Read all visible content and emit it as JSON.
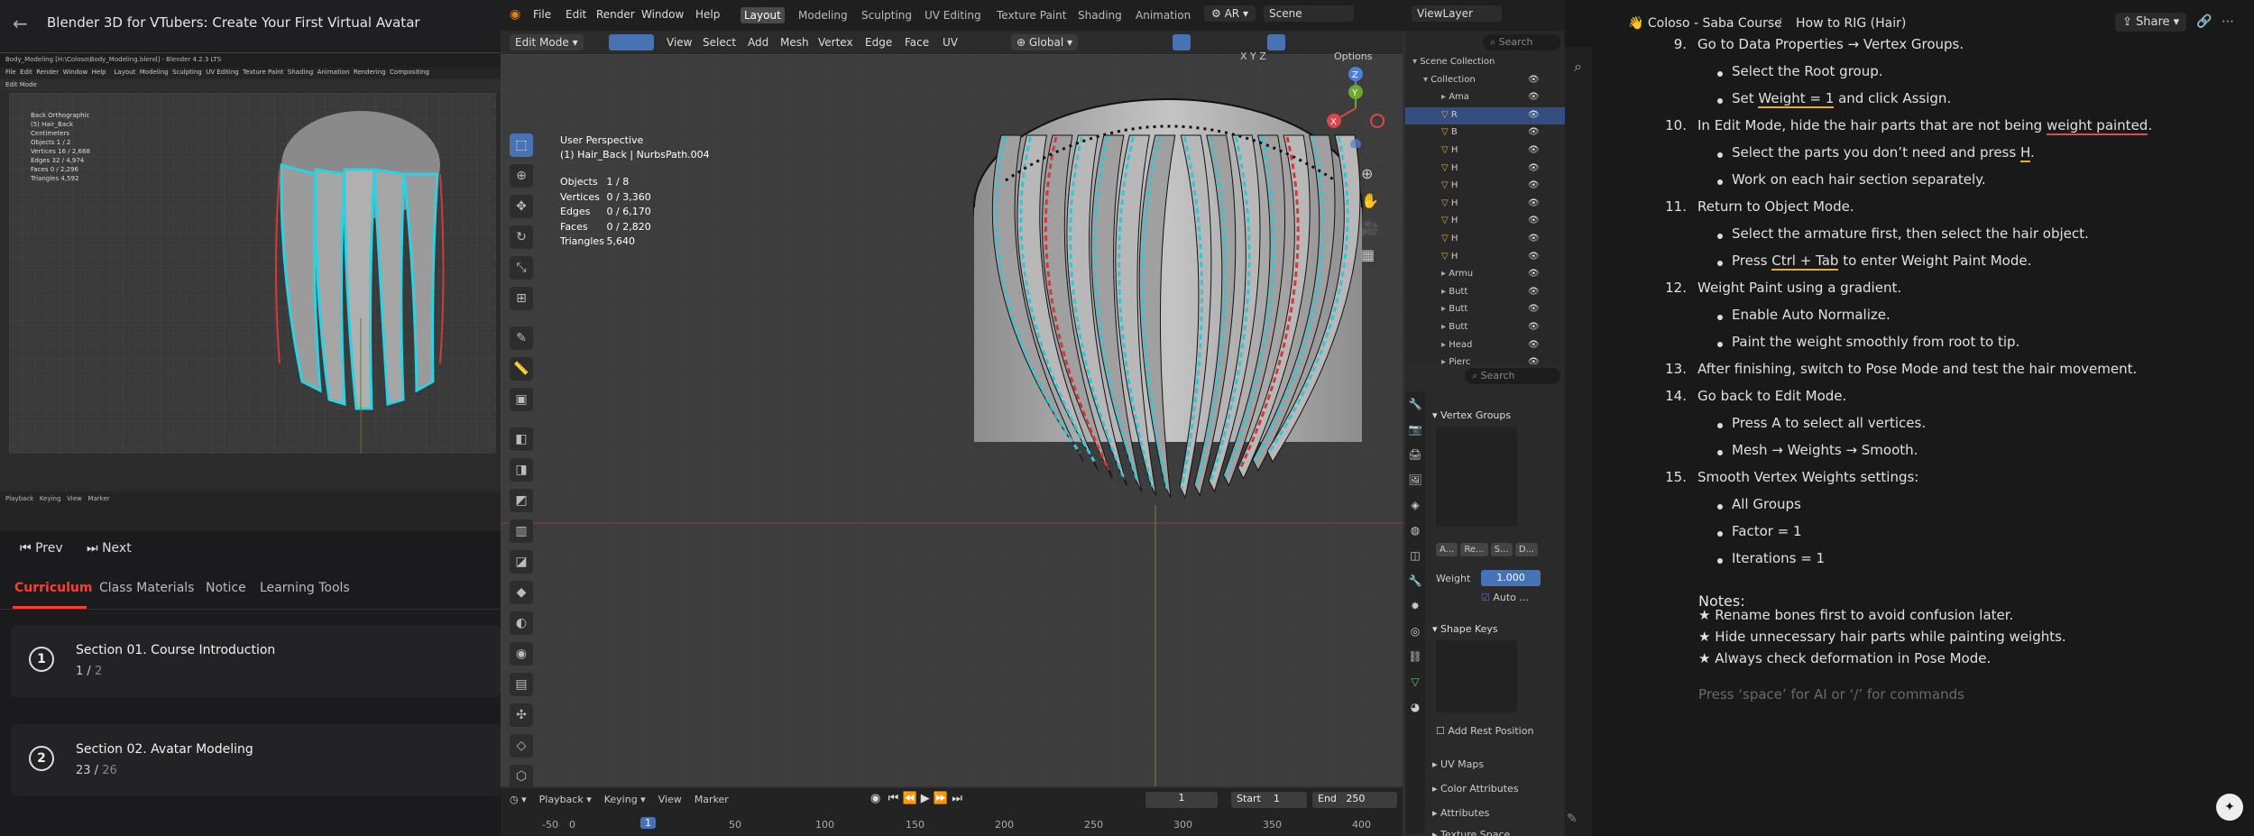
{
  "course": {
    "title": "Blender 3D for VTubers: Create Your First Virtual Avatar",
    "mini_window_title": "Body_Modeling [H:\\Coloso\\Body_Modeling.blend] - Blender 4.2.3 LTS",
    "mini_menu": [
      "File",
      "Edit",
      "Render",
      "Window",
      "Help"
    ],
    "mini_tabs": [
      "Layout",
      "Modeling",
      "Sculpting",
      "UV Editing",
      "Texture Paint",
      "Shading",
      "Animation",
      "Rendering",
      "Compositing"
    ],
    "mini_mode": "Edit Mode",
    "mini_stats": [
      "Back Orthographic",
      "(5) Hair_Back",
      "Centimeters",
      "Objects   1 / 2",
      "Vertices  16 / 2,688",
      "Edges     32 / 4,974",
      "Faces     0 / 2,296",
      "Triangles 4,592"
    ],
    "mini_timeline": [
      "Playback",
      "Keying",
      "View",
      "Marker"
    ],
    "prev_label": "Prev",
    "next_label": "Next",
    "tabs": [
      "Curriculum",
      "Class Materials",
      "Notice",
      "Learning Tools"
    ],
    "sections": [
      {
        "num": "1",
        "title": "Section 01. Course Introduction",
        "done": "1 /",
        "total": "2"
      },
      {
        "num": "2",
        "title": "Section 02. Avatar Modeling",
        "done": "23 /",
        "total": "26"
      }
    ]
  },
  "blender": {
    "menu": [
      "File",
      "Edit",
      "Render",
      "Window",
      "Help"
    ],
    "workspaces": [
      "Layout",
      "Modeling",
      "Sculpting",
      "UV Editing",
      "Texture Paint",
      "Shading",
      "Animation"
    ],
    "active_workspace": "Layout",
    "language": "AR",
    "scene": "Scene",
    "view_layer": "ViewLayer",
    "mode": "Edit Mode",
    "header_menus": [
      "View",
      "Select",
      "Add",
      "Mesh",
      "Vertex",
      "Edge",
      "Face",
      "UV"
    ],
    "orientation": "Global",
    "options_label": "Options",
    "axes": [
      "X",
      "Y",
      "Z"
    ],
    "view_name": "User Perspective",
    "object_name": "(1) Hair_Back | NurbsPath.004",
    "stats": [
      {
        "label": "Objects",
        "value": "1 / 8"
      },
      {
        "label": "Vertices",
        "value": "0 / 3,360"
      },
      {
        "label": "Edges",
        "value": "0 / 6,170"
      },
      {
        "label": "Faces",
        "value": "0 / 2,820"
      },
      {
        "label": "Triangles",
        "value": "5,640"
      }
    ],
    "timeline": {
      "menus": [
        "Playback",
        "Keying",
        "View",
        "Marker"
      ],
      "current_frame": "1",
      "start_label": "Start",
      "start": "1",
      "end_label": "End",
      "end": "250",
      "ruler": [
        "-50",
        "0",
        "1",
        "50",
        "100",
        "150",
        "200",
        "250",
        "300",
        "350",
        "400"
      ]
    },
    "outliner": {
      "search_placeholder": "Search",
      "items": [
        "Scene Collection",
        "Collection",
        "Ama",
        "R",
        "B",
        "H",
        "H",
        "H",
        "H",
        "H",
        "H",
        "H",
        "Armu",
        "Butt",
        "Butt",
        "Butt",
        "Head",
        "Pierc"
      ]
    },
    "properties": {
      "search_placeholder": "Search",
      "vertex_groups": "Vertex Groups",
      "vg_buttons": [
        "A...",
        "Re...",
        "S...",
        "D..."
      ],
      "weight_label": "Weight",
      "weight_value": "1.000",
      "auto_label": "Auto ...",
      "shape_keys": "Shape Keys",
      "add_rest": "Add Rest Position",
      "uv_maps": "UV Maps",
      "color_attributes": "Color Attributes",
      "attributes": "Attributes",
      "texture_space": "Texture Space"
    }
  },
  "notes": {
    "crumb_course": "Coloso - Saba Course",
    "crumb_page": "How to RIG (Hair)",
    "share_label": "Share",
    "items": [
      {
        "type": "num",
        "num": "9.",
        "text": "Go to Data Properties → Vertex Groups."
      },
      {
        "type": "bullet",
        "text": "Select the Root group."
      },
      {
        "type": "bullet",
        "parts": [
          "Set ",
          "Weight = 1",
          " and click Assign."
        ]
      },
      {
        "type": "num",
        "num": "10.",
        "parts": [
          "In Edit Mode, hide the hair parts that are not being ",
          "weight painted",
          "."
        ]
      },
      {
        "type": "bullet",
        "parts": [
          "Select the parts you don’t need and press ",
          "H",
          "."
        ]
      },
      {
        "type": "bullet",
        "text": "Work on each hair section separately."
      },
      {
        "type": "num",
        "num": "11.",
        "text": "Return to Object Mode."
      },
      {
        "type": "bullet",
        "text": "Select the armature first, then select the hair object."
      },
      {
        "type": "bullet",
        "parts": [
          "Press ",
          "Ctrl + Tab",
          " to enter Weight Paint Mode."
        ]
      },
      {
        "type": "num",
        "num": "12.",
        "text": "Weight Paint using a gradient."
      },
      {
        "type": "bullet",
        "text": "Enable Auto Normalize."
      },
      {
        "type": "bullet",
        "text": "Paint the weight smoothly from root to tip."
      },
      {
        "type": "num",
        "num": "13.",
        "text": "After finishing, switch to Pose Mode and test the hair movement."
      },
      {
        "type": "num",
        "num": "14.",
        "text": "Go back to Edit Mode."
      },
      {
        "type": "bullet",
        "text": "Press A to select all vertices."
      },
      {
        "type": "bullet",
        "text": "Mesh → Weights → Smooth."
      },
      {
        "type": "num",
        "num": "15.",
        "text": "Smooth Vertex Weights settings:"
      },
      {
        "type": "bullet",
        "text": "All Groups"
      },
      {
        "type": "bullet",
        "text": "Factor = 1"
      },
      {
        "type": "bullet",
        "text": "Iterations = 1"
      }
    ],
    "notes_title": "Notes:",
    "notes_lines": [
      "★ Rename bones first to avoid confusion later.",
      "★ Hide unnecessary hair parts while painting weights.",
      "★ Always check deformation in Pose Mode."
    ],
    "placeholder": "Press ‘space’ for AI or ‘/’ for commands"
  },
  "colors": {
    "accent": "#ff3c2f",
    "blender_blue": "#4772b3",
    "hair_cyan": "#34c6d6",
    "underline_yellow": "#e5b02d"
  }
}
